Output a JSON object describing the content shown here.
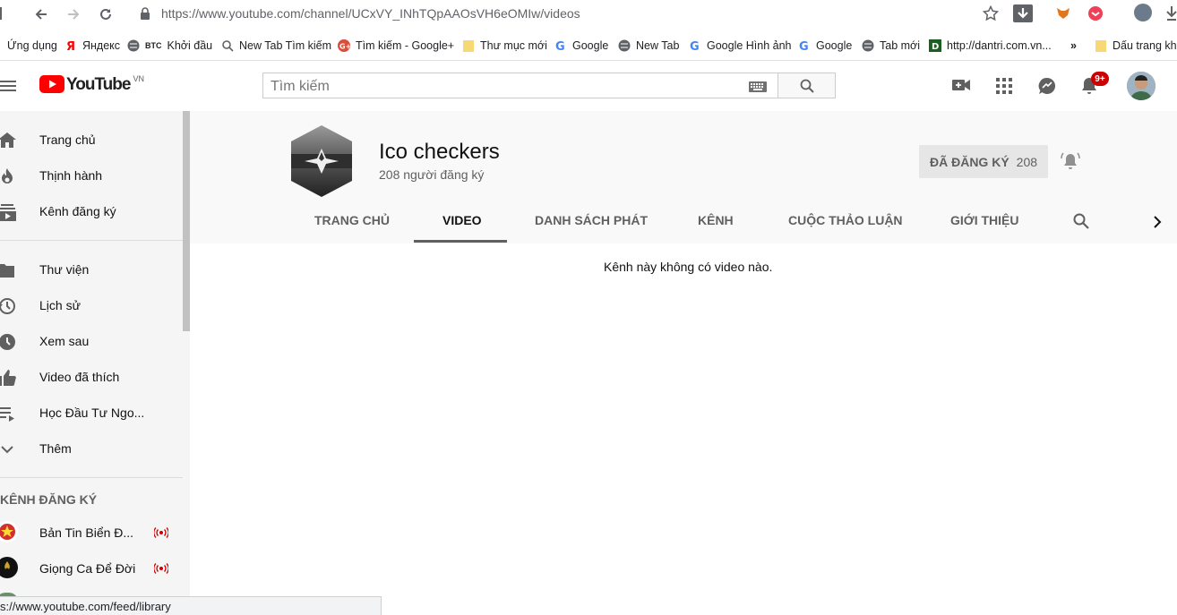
{
  "browser": {
    "url_prefix": "https://www.youtube.com",
    "url_path": "/channel/UCxVY_INhTQpAAOsVH6eOMIw/videos",
    "bookmarks": [
      {
        "label": "Ứng dụng"
      },
      {
        "label": "Яндекс"
      },
      {
        "label": "Khởi đầu"
      },
      {
        "label": "New Tab Tìm kiếm"
      },
      {
        "label": "Tìm kiếm - Google+"
      },
      {
        "label": "Thư mục mới"
      },
      {
        "label": "Google"
      },
      {
        "label": "New Tab"
      },
      {
        "label": "Google Hình ảnh"
      },
      {
        "label": "Google"
      },
      {
        "label": "Tab mới"
      },
      {
        "label": "http://dantri.com.vn..."
      },
      {
        "label": "Dấu trang kh"
      }
    ],
    "btc_label": "BTC",
    "overflow_label": "»"
  },
  "masthead": {
    "logo_text": "YouTube",
    "region": "VN",
    "search_placeholder": "Tìm kiếm",
    "notification_count": "9+"
  },
  "sidebar": {
    "items": [
      {
        "label": "Trang chủ",
        "icon": "home-icon"
      },
      {
        "label": "Thịnh hành",
        "icon": "fire-icon"
      },
      {
        "label": "Kênh đăng ký",
        "icon": "subscriptions-icon"
      },
      {
        "label": "Thư viện",
        "icon": "folder-icon"
      },
      {
        "label": "Lịch sử",
        "icon": "history-icon"
      },
      {
        "label": "Xem sau",
        "icon": "clock-icon"
      },
      {
        "label": "Video đã thích",
        "icon": "thumb-up-icon"
      },
      {
        "label": "Học Đầu Tư Ngo...",
        "icon": "playlist-icon"
      },
      {
        "label": "Thêm",
        "icon": "chevron-down-icon"
      }
    ],
    "subscriptions_heading": "KÊNH ĐĂNG KÝ",
    "subscriptions": [
      {
        "label": "Bản Tin Biển Đ..."
      },
      {
        "label": "Giọng Ca Để Đời"
      }
    ]
  },
  "channel": {
    "name": "Ico checkers",
    "subscribers": "208 người đăng ký",
    "subscribed_label": "ĐÃ ĐĂNG KÝ",
    "subscribed_count": "208",
    "tabs": [
      {
        "label": "TRANG CHỦ"
      },
      {
        "label": "VIDEO"
      },
      {
        "label": "DANH SÁCH PHÁT"
      },
      {
        "label": "KÊNH"
      },
      {
        "label": "CUỘC THẢO LUẬN"
      },
      {
        "label": "GIỚI THIỆU"
      }
    ],
    "empty_message": "Kênh này không có video nào."
  },
  "status_bar": {
    "url": "s://www.youtube.com/feed/library"
  },
  "colors": {
    "youtube_red": "#ff0000",
    "sidebar_bg": "#f5f5f5",
    "header_bg": "#f9f9f9",
    "live_red": "#cc0000"
  }
}
